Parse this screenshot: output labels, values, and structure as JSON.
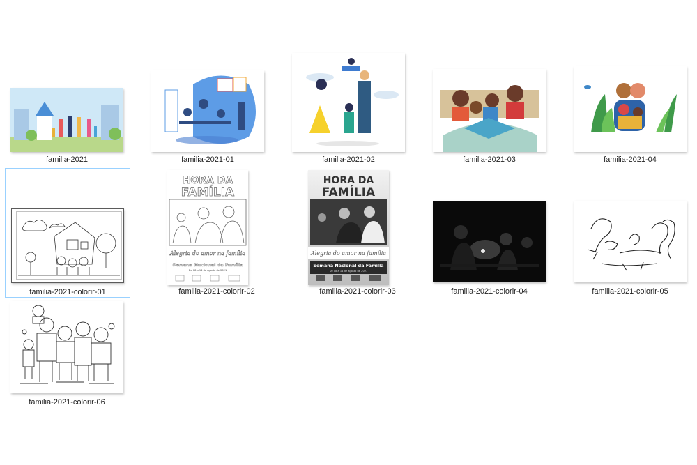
{
  "files": [
    {
      "name": "familia-2021"
    },
    {
      "name": "familia-2021-01"
    },
    {
      "name": "familia-2021-02"
    },
    {
      "name": "familia-2021-03"
    },
    {
      "name": "familia-2021-04"
    },
    {
      "name": "familia-2021-colorir-01"
    },
    {
      "name": "familia-2021-colorir-02"
    },
    {
      "name": "familia-2021-colorir-03"
    },
    {
      "name": "familia-2021-colorir-04"
    },
    {
      "name": "familia-2021-colorir-05"
    },
    {
      "name": "familia-2021-colorir-06"
    }
  ],
  "poster": {
    "title_line1": "HORA DA",
    "title_line2": "FAMÍLIA",
    "slogan": "Alegria do amor na família",
    "event": "Semana Nacional da Família",
    "dates": "De 08 a 14 de agosto de 2021"
  },
  "selected_index": 5,
  "colors": {
    "selection_border": "#99d1ff",
    "label_text": "#222222"
  }
}
